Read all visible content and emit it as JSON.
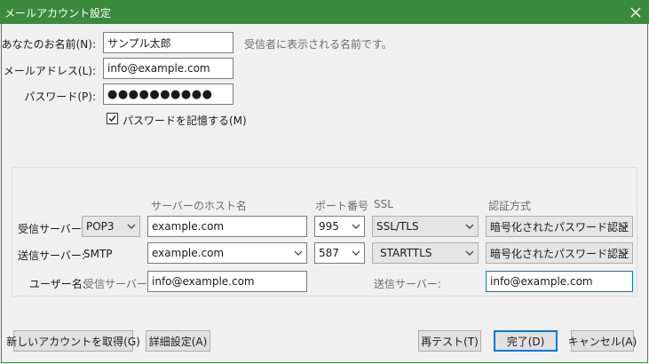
{
  "window": {
    "title": "メールアカウント設定"
  },
  "account": {
    "name_label": "あなたのお名前(N):",
    "name_value": "サンプル太郎",
    "name_hint": "受信者に表示される名前です。",
    "email_label": "メールアドレス(L):",
    "email_value": "info@example.com",
    "password_label": "パスワード(P):",
    "password_value": "●●●●●●●●●●",
    "remember_label": "パスワードを記憶する(M)",
    "remember_checked": true
  },
  "servers": {
    "col_hostname": "サーバーのホスト名",
    "col_port": "ポート番号",
    "col_ssl": "SSL",
    "col_auth": "認証方式",
    "incoming": {
      "label": "受信サーバー:",
      "protocol": "POP3",
      "host": "example.com",
      "port": "995",
      "ssl": "SSL/TLS",
      "auth": "暗号化されたパスワード認証"
    },
    "outgoing": {
      "label": "送信サーバー:",
      "protocol": "SMTP",
      "host": "example.com",
      "port": "587",
      "ssl": "STARTTLS",
      "auth": "暗号化されたパスワード認証"
    },
    "username": {
      "label": "ユーザー名:",
      "incoming_label": "受信サーバー:",
      "incoming_value": "info@example.com",
      "outgoing_label": "送信サーバー:",
      "outgoing_value": "info@example.com"
    }
  },
  "buttons": {
    "get_account": "新しいアカウントを取得(G)",
    "advanced": "詳細設定(A)",
    "retest": "再テスト(T)",
    "done": "完了(D)",
    "cancel": "キャンセル(A)"
  },
  "colors": {
    "titlebar": "#3c8a3d",
    "focus": "#0078d7"
  }
}
